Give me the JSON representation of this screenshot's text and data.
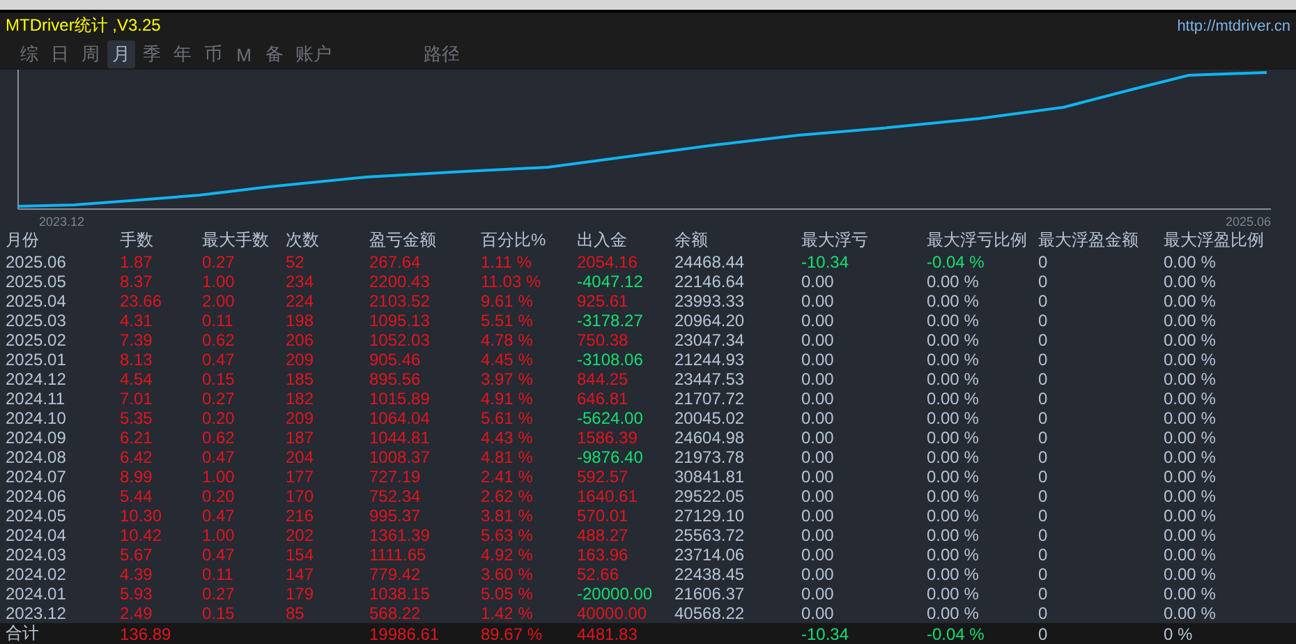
{
  "header": {
    "title": "MTDriver统计 ,V3.25",
    "url": "http://mtdriver.cn"
  },
  "tabs": [
    {
      "label": "综",
      "selected": false
    },
    {
      "label": "日",
      "selected": false
    },
    {
      "label": "周",
      "selected": false
    },
    {
      "label": "月",
      "selected": true
    },
    {
      "label": "季",
      "selected": false
    },
    {
      "label": "年",
      "selected": false
    },
    {
      "label": "币",
      "selected": false
    },
    {
      "label": "M",
      "selected": false
    },
    {
      "label": "备",
      "selected": false
    },
    {
      "label": "账户",
      "selected": false
    },
    {
      "label": "路径",
      "selected": false
    }
  ],
  "chart": {
    "start_label": "2023.12",
    "end_label": "2025.06"
  },
  "table": {
    "columns": [
      "月份",
      "手数",
      "最大手数",
      "次数",
      "盈亏金额",
      "百分比%",
      "出入金",
      "余额",
      "最大浮亏",
      "最大浮亏比例",
      "最大浮盈金额",
      "最大浮盈比例"
    ],
    "rows": [
      {
        "values": [
          "2025.06",
          "1.87",
          "0.27",
          "52",
          "267.64",
          "1.11 %",
          "2054.16",
          "24468.44",
          "-10.34",
          "-0.04 %",
          "0",
          "0.00 %"
        ],
        "withdrawal": false,
        "float_loss": true
      },
      {
        "values": [
          "2025.05",
          "8.37",
          "1.00",
          "234",
          "2200.43",
          "11.03 %",
          "-4047.12",
          "22146.64",
          "0.00",
          "0.00 %",
          "0",
          "0.00 %"
        ],
        "withdrawal": true,
        "float_loss": false
      },
      {
        "values": [
          "2025.04",
          "23.66",
          "2.00",
          "224",
          "2103.52",
          "9.61 %",
          "925.61",
          "23993.33",
          "0.00",
          "0.00 %",
          "0",
          "0.00 %"
        ],
        "withdrawal": false,
        "float_loss": false
      },
      {
        "values": [
          "2025.03",
          "4.31",
          "0.11",
          "198",
          "1095.13",
          "5.51 %",
          "-3178.27",
          "20964.20",
          "0.00",
          "0.00 %",
          "0",
          "0.00 %"
        ],
        "withdrawal": true,
        "float_loss": false
      },
      {
        "values": [
          "2025.02",
          "7.39",
          "0.62",
          "206",
          "1052.03",
          "4.78 %",
          "750.38",
          "23047.34",
          "0.00",
          "0.00 %",
          "0",
          "0.00 %"
        ],
        "withdrawal": false,
        "float_loss": false
      },
      {
        "values": [
          "2025.01",
          "8.13",
          "0.47",
          "209",
          "905.46",
          "4.45 %",
          "-3108.06",
          "21244.93",
          "0.00",
          "0.00 %",
          "0",
          "0.00 %"
        ],
        "withdrawal": true,
        "float_loss": false
      },
      {
        "values": [
          "2024.12",
          "4.54",
          "0.15",
          "185",
          "895.56",
          "3.97 %",
          "844.25",
          "23447.53",
          "0.00",
          "0.00 %",
          "0",
          "0.00 %"
        ],
        "withdrawal": false,
        "float_loss": false
      },
      {
        "values": [
          "2024.11",
          "7.01",
          "0.27",
          "182",
          "1015.89",
          "4.91 %",
          "646.81",
          "21707.72",
          "0.00",
          "0.00 %",
          "0",
          "0.00 %"
        ],
        "withdrawal": false,
        "float_loss": false
      },
      {
        "values": [
          "2024.10",
          "5.35",
          "0.20",
          "209",
          "1064.04",
          "5.61 %",
          "-5624.00",
          "20045.02",
          "0.00",
          "0.00 %",
          "0",
          "0.00 %"
        ],
        "withdrawal": true,
        "float_loss": false
      },
      {
        "values": [
          "2024.09",
          "6.21",
          "0.62",
          "187",
          "1044.81",
          "4.43 %",
          "1586.39",
          "24604.98",
          "0.00",
          "0.00 %",
          "0",
          "0.00 %"
        ],
        "withdrawal": false,
        "float_loss": false
      },
      {
        "values": [
          "2024.08",
          "6.42",
          "0.47",
          "204",
          "1008.37",
          "4.81 %",
          "-9876.40",
          "21973.78",
          "0.00",
          "0.00 %",
          "0",
          "0.00 %"
        ],
        "withdrawal": true,
        "float_loss": false
      },
      {
        "values": [
          "2024.07",
          "8.99",
          "1.00",
          "177",
          "727.19",
          "2.41 %",
          "592.57",
          "30841.81",
          "0.00",
          "0.00 %",
          "0",
          "0.00 %"
        ],
        "withdrawal": false,
        "float_loss": false
      },
      {
        "values": [
          "2024.06",
          "5.44",
          "0.20",
          "170",
          "752.34",
          "2.62 %",
          "1640.61",
          "29522.05",
          "0.00",
          "0.00 %",
          "0",
          "0.00 %"
        ],
        "withdrawal": false,
        "float_loss": false
      },
      {
        "values": [
          "2024.05",
          "10.30",
          "0.47",
          "216",
          "995.37",
          "3.81 %",
          "570.01",
          "27129.10",
          "0.00",
          "0.00 %",
          "0",
          "0.00 %"
        ],
        "withdrawal": false,
        "float_loss": false
      },
      {
        "values": [
          "2024.04",
          "10.42",
          "1.00",
          "202",
          "1361.39",
          "5.63 %",
          "488.27",
          "25563.72",
          "0.00",
          "0.00 %",
          "0",
          "0.00 %"
        ],
        "withdrawal": false,
        "float_loss": false
      },
      {
        "values": [
          "2024.03",
          "5.67",
          "0.47",
          "154",
          "1111.65",
          "4.92 %",
          "163.96",
          "23714.06",
          "0.00",
          "0.00 %",
          "0",
          "0.00 %"
        ],
        "withdrawal": false,
        "float_loss": false
      },
      {
        "values": [
          "2024.02",
          "4.39",
          "0.11",
          "147",
          "779.42",
          "3.60 %",
          "52.66",
          "22438.45",
          "0.00",
          "0.00 %",
          "0",
          "0.00 %"
        ],
        "withdrawal": false,
        "float_loss": false
      },
      {
        "values": [
          "2024.01",
          "5.93",
          "0.27",
          "179",
          "1038.15",
          "5.05 %",
          "-20000.00",
          "21606.37",
          "0.00",
          "0.00 %",
          "0",
          "0.00 %"
        ],
        "withdrawal": true,
        "float_loss": false
      },
      {
        "values": [
          "2023.12",
          "2.49",
          "0.15",
          "85",
          "568.22",
          "1.42 %",
          "40000.00",
          "40568.22",
          "0.00",
          "0.00 %",
          "0",
          "0.00 %"
        ],
        "withdrawal": false,
        "float_loss": false
      }
    ],
    "total": {
      "label": "合计",
      "lots": "136.89",
      "profit": "19986.61",
      "percent": "89.67 %",
      "flow": "4481.83",
      "max_float_loss": "-10.34",
      "max_float_loss_pct": "-0.04 %",
      "max_float_profit": "0",
      "max_float_profit_pct": "0 %",
      "withdrawal": false,
      "float_loss": true
    }
  }
}
